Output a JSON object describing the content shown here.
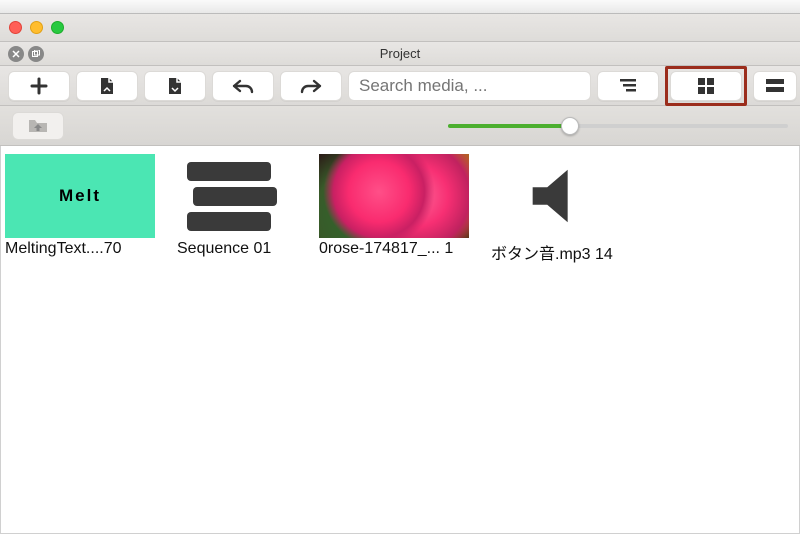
{
  "panel": {
    "title": "Project"
  },
  "toolbar": {
    "search_placeholder": "Search media, ..."
  },
  "slider": {
    "value_percent": 36
  },
  "media": [
    {
      "kind": "title",
      "thumb_text": "Melt",
      "caption": "MeltingText....70"
    },
    {
      "kind": "sequence",
      "caption": "Sequence 01"
    },
    {
      "kind": "image",
      "caption": "0rose-174817_... 1"
    },
    {
      "kind": "audio",
      "caption": "ボタン音.mp3 14"
    }
  ]
}
